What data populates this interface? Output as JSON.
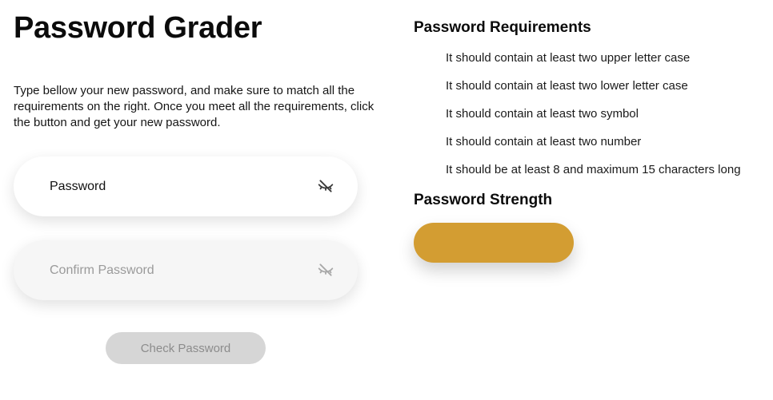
{
  "header": {
    "title": "Password Grader"
  },
  "intro": {
    "text": "Type bellow your new password, and make sure to match all the requirements on the right. Once you meet all the requirements, click the button and get your new password."
  },
  "form": {
    "password": {
      "placeholder": "Password",
      "value": ""
    },
    "confirm": {
      "placeholder": "Confirm Password",
      "value": ""
    },
    "eye_icon": "eye-off-icon",
    "check_button": "Check Password"
  },
  "requirements": {
    "title": "Password Requirements",
    "items": [
      "It should contain at least two upper letter case",
      "It should contain at least two lower letter case",
      "It should contain at least two symbol",
      "It should contain at least two number",
      "It should be at least 8 and maximum 15 characters long"
    ]
  },
  "strength": {
    "title": "Password Strength",
    "color": "#d39d32"
  },
  "colors": {
    "strength_bar": "#d39d32",
    "button_bg": "#d6d6d6",
    "button_text": "#8c8c8c"
  }
}
